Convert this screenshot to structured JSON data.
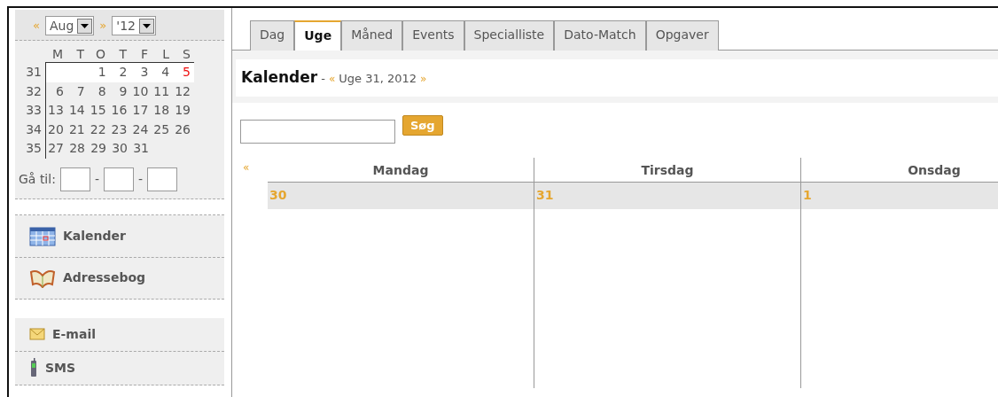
{
  "mini_calendar": {
    "prev": "«",
    "month": "Aug",
    "next": "»",
    "year": "'12",
    "weekdays": [
      "M",
      "T",
      "O",
      "T",
      "F",
      "L",
      "S"
    ],
    "weeks": [
      {
        "number": "31",
        "selected": true,
        "kind": "first",
        "days": [
          {
            "label": "1",
            "today": false
          },
          {
            "label": "2",
            "today": false
          },
          {
            "label": "3",
            "today": false
          },
          {
            "label": "4",
            "today": false
          },
          {
            "label": "5",
            "today": true
          }
        ]
      },
      {
        "number": "32",
        "selected": false,
        "kind": "full",
        "days": [
          {
            "label": "6",
            "today": false
          },
          {
            "label": "7",
            "today": false
          },
          {
            "label": "8",
            "today": false
          },
          {
            "label": "9",
            "today": false
          },
          {
            "label": "10",
            "today": false
          },
          {
            "label": "11",
            "today": false
          },
          {
            "label": "12",
            "today": false
          }
        ]
      },
      {
        "number": "33",
        "selected": false,
        "kind": "full",
        "days": [
          {
            "label": "13",
            "today": false
          },
          {
            "label": "14",
            "today": false
          },
          {
            "label": "15",
            "today": false
          },
          {
            "label": "16",
            "today": false
          },
          {
            "label": "17",
            "today": false
          },
          {
            "label": "18",
            "today": false
          },
          {
            "label": "19",
            "today": false
          }
        ]
      },
      {
        "number": "34",
        "selected": false,
        "kind": "full",
        "days": [
          {
            "label": "20",
            "today": false
          },
          {
            "label": "21",
            "today": false
          },
          {
            "label": "22",
            "today": false
          },
          {
            "label": "23",
            "today": false
          },
          {
            "label": "24",
            "today": false
          },
          {
            "label": "25",
            "today": false
          },
          {
            "label": "26",
            "today": false
          }
        ]
      },
      {
        "number": "35",
        "selected": false,
        "kind": "last",
        "days": [
          {
            "label": "27",
            "today": false
          },
          {
            "label": "28",
            "today": false
          },
          {
            "label": "29",
            "today": false
          },
          {
            "label": "30",
            "today": false
          },
          {
            "label": "31",
            "today": false
          }
        ]
      }
    ],
    "goto": {
      "label": "Gå til:",
      "separators": [
        "-",
        "-"
      ]
    }
  },
  "nav_groups": [
    [
      {
        "label": "Kalender",
        "kind": "calendar"
      },
      {
        "label": "Adressebog",
        "kind": "book"
      }
    ],
    [
      {
        "label": "E-mail",
        "kind": "mail"
      },
      {
        "label": "SMS",
        "kind": "phone"
      }
    ]
  ],
  "tabs": [
    {
      "label": "Dag",
      "selected": false
    },
    {
      "label": "Uge",
      "selected": true
    },
    {
      "label": "Måned",
      "selected": false
    },
    {
      "label": "Events",
      "selected": false
    },
    {
      "label": "Specialliste",
      "selected": false
    },
    {
      "label": "Dato-Match",
      "selected": false
    },
    {
      "label": "Opgaver",
      "selected": false
    }
  ],
  "heading": {
    "title": "Kalender",
    "separator": "-",
    "prev": "«",
    "period": "Uge 31, 2012",
    "next": "»"
  },
  "search": {
    "button": "Søg"
  },
  "week": {
    "prev": "«",
    "days": [
      {
        "name": "Mandag",
        "date": "30"
      },
      {
        "name": "Tirsdag",
        "date": "31"
      },
      {
        "name": "Onsdag",
        "date": "1"
      }
    ]
  }
}
